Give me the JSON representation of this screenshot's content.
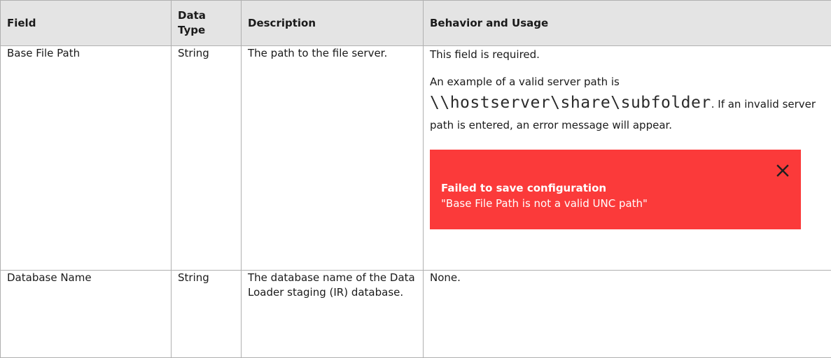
{
  "table": {
    "headers": [
      "Field",
      "Data Type",
      "Description",
      "Behavior and Usage"
    ],
    "rows": [
      {
        "field": "Base File Path",
        "data_type": "String",
        "description": "The path to the file server.",
        "usage": {
          "required_note": "This field is required.",
          "example_prefix": "An example of a valid server path is",
          "example_path": "\\\\hostserver\\share\\subfolder",
          "example_suffix": ". If an invalid server path is entered, an error message will appear.",
          "error_banner": {
            "title": "Failed to save configuration",
            "message": "\"Base File Path is not a valid UNC path\"",
            "icon": "close-icon",
            "color": "#fb3a3a"
          }
        }
      },
      {
        "field": "Database Name",
        "data_type": "String",
        "description": "The database name of the Data Loader staging (IR) database.",
        "usage": {
          "text": "None."
        }
      }
    ]
  }
}
